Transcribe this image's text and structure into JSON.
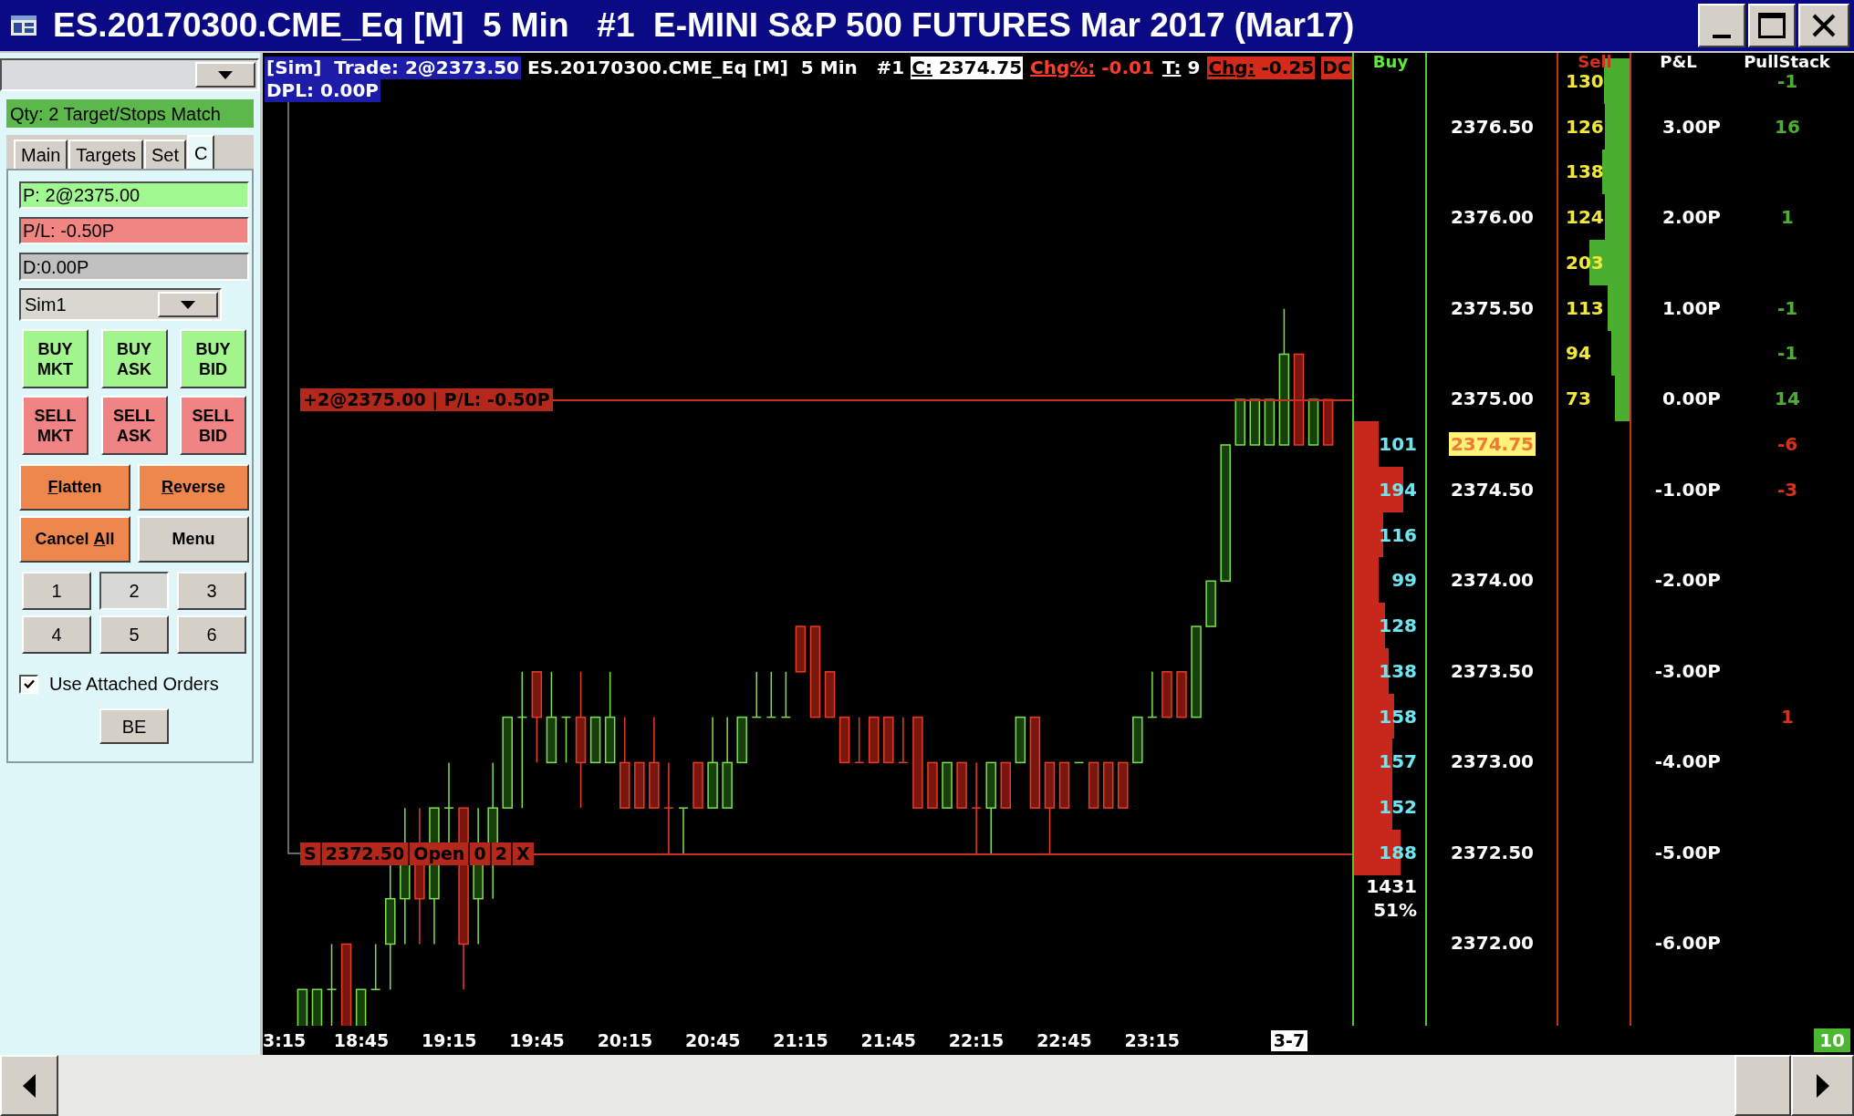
{
  "window": {
    "title": "ES.20170300.CME_Eq [M]  5 Min   #1  E-MINI S&P 500 FUTURES Mar 2017 (Mar17)"
  },
  "order_panel": {
    "status": "Qty: 2 Target/Stops Match",
    "tabs": [
      {
        "label": "Main",
        "selected": false
      },
      {
        "label": "Targets",
        "selected": false
      },
      {
        "label": "Set",
        "selected": false
      },
      {
        "label": "C",
        "selected": true
      }
    ],
    "position": "P: 2@2375.00",
    "profit_loss": "P/L: -0.50P",
    "daily": "D:0.00P",
    "account": "Sim1",
    "order_buttons": [
      {
        "label": "BUY MKT",
        "kind": "buy"
      },
      {
        "label": "BUY ASK",
        "kind": "buy"
      },
      {
        "label": "BUY BID",
        "kind": "buy"
      },
      {
        "label": "SELL MKT",
        "kind": "sell"
      },
      {
        "label": "SELL ASK",
        "kind": "sell"
      },
      {
        "label": "SELL BID",
        "kind": "sell"
      }
    ],
    "action_buttons": [
      {
        "kind": "orange",
        "parts": [
          {
            "text": "F",
            "underline": true
          },
          {
            "text": "latten",
            "underline": false
          }
        ]
      },
      {
        "kind": "orange",
        "parts": [
          {
            "text": "R",
            "underline": true
          },
          {
            "text": "everse",
            "underline": false
          }
        ]
      },
      {
        "kind": "orange",
        "parts": [
          {
            "text": "Cancel ",
            "underline": false
          },
          {
            "text": "A",
            "underline": true
          },
          {
            "text": "ll",
            "underline": false
          }
        ]
      },
      {
        "kind": "plain",
        "parts": [
          {
            "text": "Menu",
            "underline": false
          }
        ]
      }
    ],
    "quantity_buttons": [
      {
        "label": "1",
        "selected": false
      },
      {
        "label": "2",
        "selected": true
      },
      {
        "label": "3",
        "selected": false
      },
      {
        "label": "4",
        "selected": false
      },
      {
        "label": "5",
        "selected": false
      },
      {
        "label": "6",
        "selected": false
      }
    ],
    "attached_orders": {
      "label": "Use Attached Orders",
      "checked": true
    },
    "be_button": "BE"
  },
  "chart": {
    "header": {
      "trade": "[Sim]  Trade: 2@2373.50",
      "symbol": "ES.20170300.CME_Eq [M]  5 Min   #1",
      "readouts": [
        {
          "kind": "last",
          "label": "C:",
          "value": "2374.75"
        },
        {
          "kind": "change_pct",
          "label": "Chg%:",
          "value": "-0.01"
        },
        {
          "kind": "trades",
          "label": "T:",
          "value": "9"
        },
        {
          "kind": "change",
          "label": "Chg:",
          "value": "-0.25"
        },
        {
          "kind": "flag",
          "label": "DC"
        }
      ],
      "dpl": "DPL: 0.00P"
    },
    "position_line": "+2@2375.00 | P/L: -0.50P",
    "stop_order": [
      "S",
      "2372.50",
      "Open",
      "0",
      "2",
      "X"
    ],
    "time_labels": [
      "3:15",
      "18:45",
      "19:15",
      "19:45",
      "20:15",
      "20:45",
      "21:15",
      "21:45",
      "22:15",
      "22:45",
      "23:15"
    ],
    "date_marker": "3-7"
  },
  "dom": {
    "headers": {
      "buy": "Buy",
      "sell": "Sell",
      "pnl": "P&L",
      "pullstack": "PullStack"
    },
    "rows": [
      {
        "ask": {
          "size": "130",
          "level": 0.36
        },
        "pullstack": {
          "value": "-1",
          "color": "#4caf32"
        }
      },
      {
        "price": {
          "value": "2376.50",
          "current": false
        },
        "ask": {
          "size": "126",
          "level": 0.35
        },
        "pnl": "3.00P",
        "pullstack": {
          "value": "16",
          "color": "#4caf32"
        }
      },
      {
        "ask": {
          "size": "138",
          "level": 0.38
        }
      },
      {
        "price": {
          "value": "2376.00",
          "current": false
        },
        "ask": {
          "size": "124",
          "level": 0.34
        },
        "pnl": "2.00P",
        "pullstack": {
          "value": "1",
          "color": "#4caf32"
        }
      },
      {
        "ask": {
          "size": "203",
          "level": 0.56
        }
      },
      {
        "price": {
          "value": "2375.50",
          "current": false
        },
        "ask": {
          "size": "113",
          "level": 0.31
        },
        "pnl": "1.00P",
        "pullstack": {
          "value": "-1",
          "color": "#4caf32"
        }
      },
      {
        "ask": {
          "size": "94",
          "level": 0.26
        },
        "pullstack": {
          "value": "-1",
          "color": "#4caf32"
        }
      },
      {
        "price": {
          "value": "2375.00",
          "current": false
        },
        "ask": {
          "size": "73",
          "level": 0.2
        },
        "pnl": "0.00P",
        "pullstack": {
          "value": "14",
          "color": "#4caf32"
        }
      },
      {
        "price": {
          "value": "2374.75",
          "current": true
        },
        "bid": {
          "size": "101",
          "level": 0.35
        },
        "pullstack": {
          "value": "-6",
          "color": "#d8321e"
        }
      },
      {
        "price": {
          "value": "2374.50",
          "current": false
        },
        "bid": {
          "size": "194",
          "level": 0.69
        },
        "pnl": "-1.00P",
        "pullstack": {
          "value": "-3",
          "color": "#d8321e"
        }
      },
      {
        "bid": {
          "size": "116",
          "level": 0.41
        }
      },
      {
        "price": {
          "value": "2374.00",
          "current": false
        },
        "bid": {
          "size": "99",
          "level": 0.35
        },
        "pnl": "-2.00P"
      },
      {
        "bid": {
          "size": "128",
          "level": 0.44
        }
      },
      {
        "price": {
          "value": "2373.50",
          "current": false
        },
        "bid": {
          "size": "138",
          "level": 0.49
        },
        "pnl": "-3.00P"
      },
      {
        "bid": {
          "size": "158",
          "level": 0.56
        },
        "pullstack": {
          "value": "1",
          "color": "#d8321e"
        }
      },
      {
        "price": {
          "value": "2373.00",
          "current": false
        },
        "bid": {
          "size": "157",
          "level": 0.54
        },
        "pnl": "-4.00P"
      },
      {
        "bid": {
          "size": "152",
          "level": 0.54
        }
      },
      {
        "price": {
          "value": "2372.50",
          "current": false
        },
        "bid": {
          "size": "188",
          "level": 0.65
        },
        "pnl": "-5.00P"
      },
      {
        "bid_total": "1431",
        "bid_share": "51%"
      },
      {
        "price": {
          "value": "2372.00",
          "current": false
        },
        "pnl": "-6.00P"
      }
    ]
  },
  "corner_badge": "10"
}
